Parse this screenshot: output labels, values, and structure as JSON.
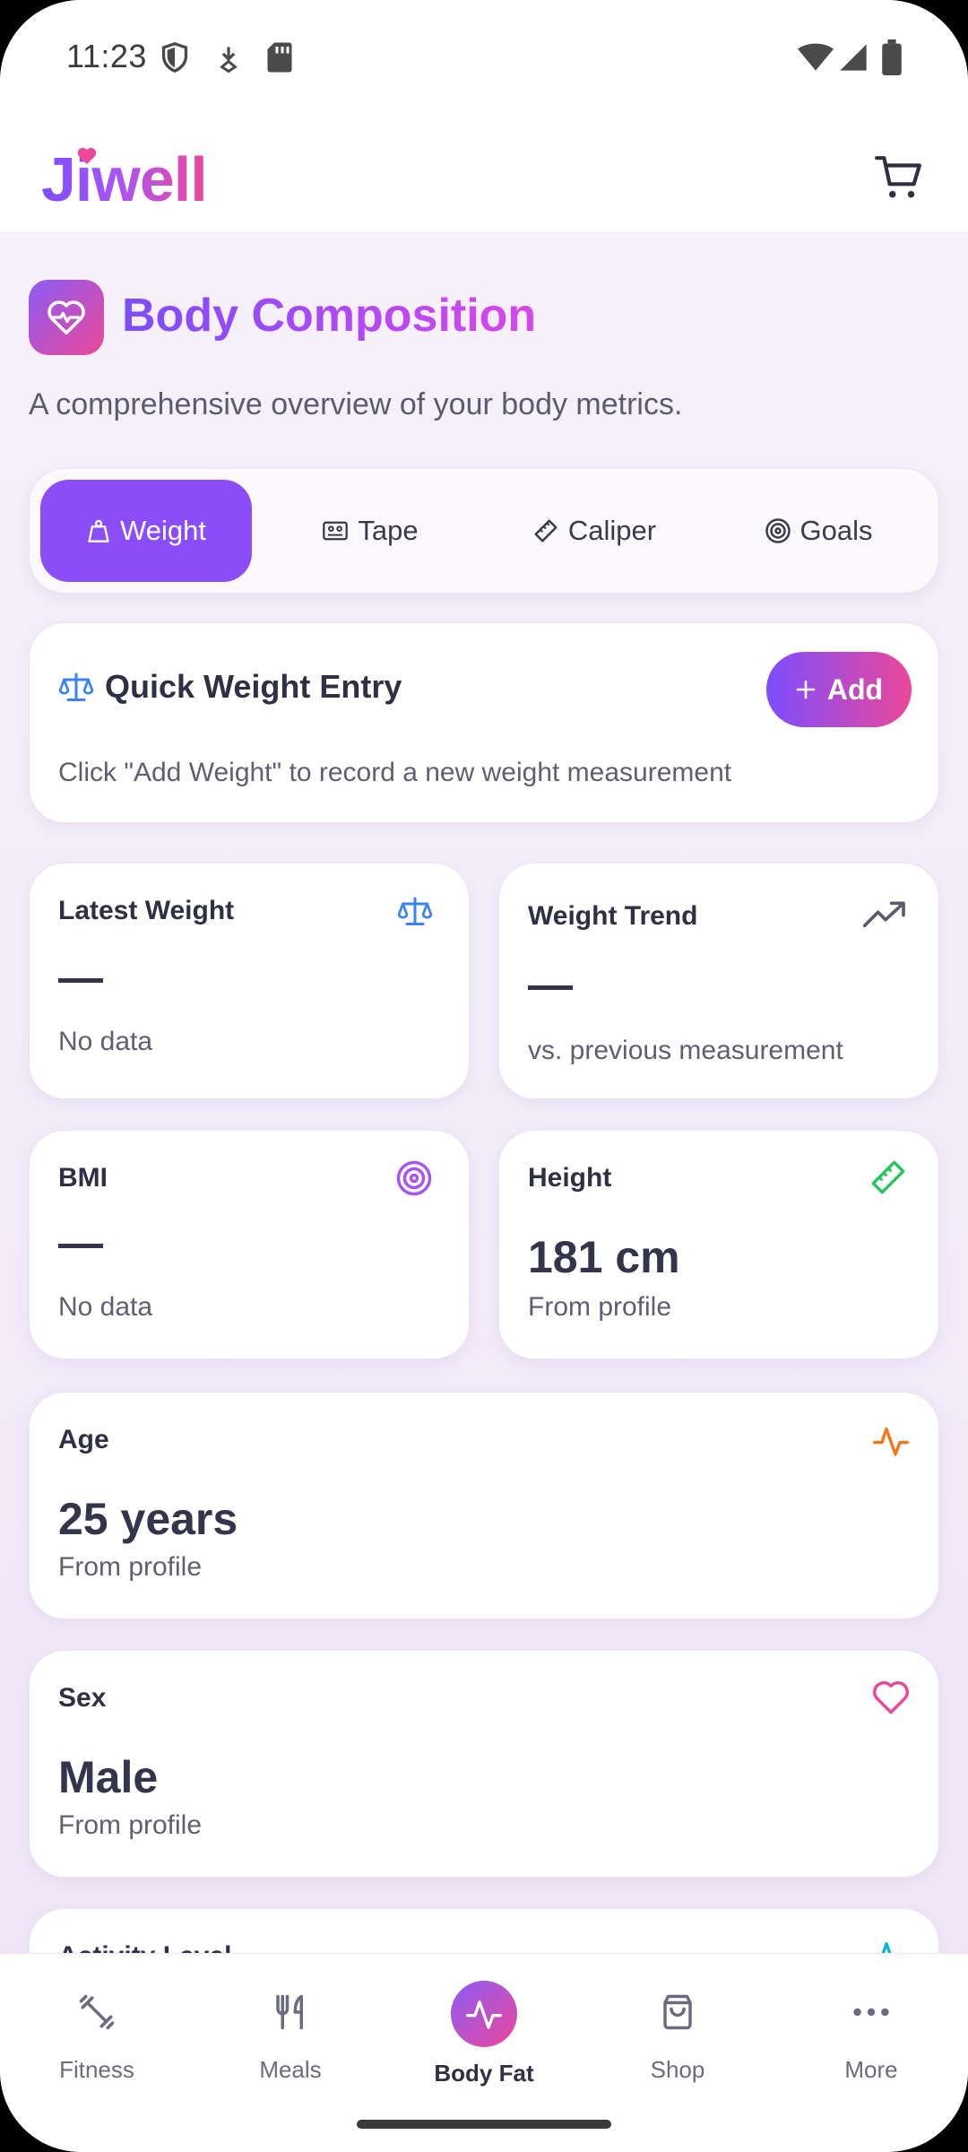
{
  "status_bar": {
    "time": "11:23"
  },
  "app": {
    "logo": "Jiwell"
  },
  "page": {
    "title": "Body Composition",
    "subtitle": "A comprehensive overview of your body metrics."
  },
  "tabs": [
    {
      "label": "Weight",
      "icon": "weight-icon",
      "active": true
    },
    {
      "label": "Tape",
      "icon": "tape-icon",
      "active": false
    },
    {
      "label": "Caliper",
      "icon": "caliper-icon",
      "active": false
    },
    {
      "label": "Goals",
      "icon": "target-icon",
      "active": false
    }
  ],
  "quick_entry": {
    "title": "Quick Weight Entry",
    "button_label": "Add",
    "description": "Click \"Add Weight\" to record a new weight measurement"
  },
  "cards": {
    "latest_weight": {
      "title": "Latest Weight",
      "value": "—",
      "note": "No data",
      "icon": "scale-icon"
    },
    "weight_trend": {
      "title": "Weight Trend",
      "value": "—",
      "note": "vs. previous measurement",
      "icon": "trending-up-icon"
    },
    "bmi": {
      "title": "BMI",
      "value": "—",
      "note": "No data",
      "icon": "target-icon"
    },
    "height": {
      "title": "Height",
      "value": "181 cm",
      "note": "From profile",
      "icon": "ruler-icon"
    },
    "age": {
      "title": "Age",
      "value": "25 years",
      "note": "From profile",
      "icon": "activity-icon"
    },
    "sex": {
      "title": "Sex",
      "value": "Male",
      "note": "From profile",
      "icon": "heart-icon"
    },
    "activity": {
      "title": "Activity Level"
    }
  },
  "bottom_nav": [
    {
      "label": "Fitness",
      "icon": "dumbbell-icon",
      "active": false
    },
    {
      "label": "Meals",
      "icon": "utensils-icon",
      "active": false
    },
    {
      "label": "Body Fat",
      "icon": "activity-icon",
      "active": true
    },
    {
      "label": "Shop",
      "icon": "shopping-bag-icon",
      "active": false
    },
    {
      "label": "More",
      "icon": "more-icon",
      "active": false
    }
  ],
  "colors": {
    "accent": "#8b4dfa",
    "gradient_start": "#7c4dff",
    "gradient_end": "#ec4899",
    "background": "#f4eef9"
  }
}
